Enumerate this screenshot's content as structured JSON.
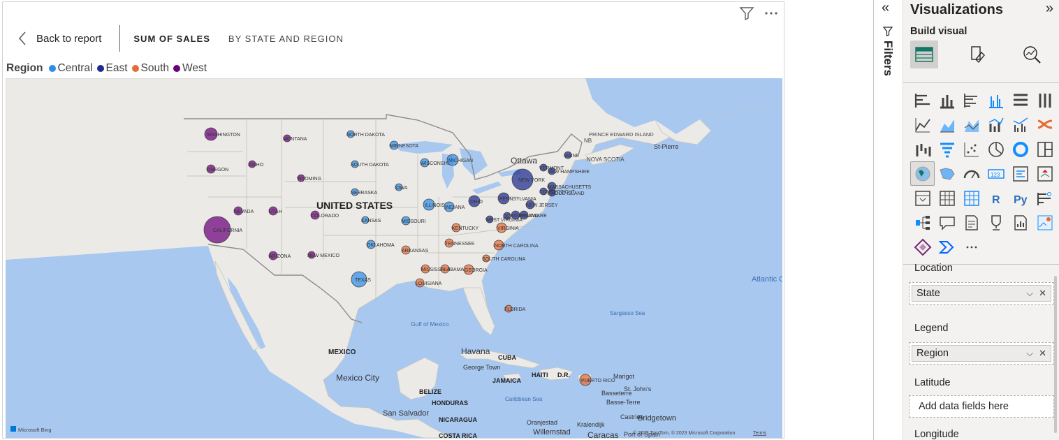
{
  "header": {
    "back_label": "Back to report",
    "crumbs": [
      "SUM OF SALES",
      "BY STATE AND REGION"
    ]
  },
  "legend": {
    "title": "Region",
    "items": [
      {
        "label": "Central",
        "color": "#2e8de6"
      },
      {
        "label": "East",
        "color": "#1b2b8f"
      },
      {
        "label": "South",
        "color": "#e66c37"
      },
      {
        "label": "West",
        "color": "#6b007b"
      }
    ]
  },
  "map": {
    "country_label": "UNITED STATES",
    "place_labels": {
      "mexico": "MEXICO",
      "mexico_city": "Mexico City",
      "cuba": "CUBA",
      "havana": "Havana",
      "george_town": "George Town",
      "jamaica": "JAMAICA",
      "haiti": "HAITI",
      "dr": "D.R.",
      "belize": "BELIZE",
      "honduras": "HONDURAS",
      "nicaragua": "NICARAGUA",
      "costa_rica": "COSTA RICA",
      "san_salvador": "San Salvador",
      "caribbean_sea": "Caribbean Sea",
      "gulf_of_mexico": "Gulf of Mexico",
      "sargasso_sea": "Sargasso Sea",
      "atlantic_ocean": "Atlantic Ocean",
      "ottawa": "Ottawa",
      "st_pierre": "St-Pierre",
      "nova_scotia": "NOVA SCOTIA",
      "pei": "PRINCE EDWARD ISLAND",
      "nb": "NB",
      "marigot": "Marigot",
      "st_johns": "St. John's",
      "basseterre": "Basseterre",
      "basse_terre": "Basse-Terre",
      "castries": "Castries",
      "bridgetown": "Bridgetown",
      "oranjestad": "Oranjestad",
      "kralendijk": "Kralendijk",
      "willemstad": "Willemstad",
      "caracas": "Caracas",
      "port_of_spain": "Port of Spain"
    },
    "attribution": "© 2022 TomTom, © 2023 Microsoft Corporation",
    "terms": "Terms",
    "bing": "Microsoft Bing",
    "bubbles": [
      {
        "state": "WASHINGTON",
        "region": "West",
        "size": 9
      },
      {
        "state": "OREGON",
        "region": "West",
        "size": 6
      },
      {
        "state": "CALIFORNIA",
        "region": "West",
        "size": 19
      },
      {
        "state": "NEVADA",
        "region": "West",
        "size": 6
      },
      {
        "state": "IDAHO",
        "region": "West",
        "size": 5
      },
      {
        "state": "MONTANA",
        "region": "West",
        "size": 5
      },
      {
        "state": "WYOMING",
        "region": "West",
        "size": 5
      },
      {
        "state": "UTAH",
        "region": "West",
        "size": 6
      },
      {
        "state": "COLORADO",
        "region": "West",
        "size": 6
      },
      {
        "state": "ARIZONA",
        "region": "West",
        "size": 6
      },
      {
        "state": "NEW MEXICO",
        "region": "West",
        "size": 5
      },
      {
        "state": "NORTH DAKOTA",
        "region": "Central",
        "size": 5
      },
      {
        "state": "SOUTH DAKOTA",
        "region": "Central",
        "size": 5
      },
      {
        "state": "NEBRASKA",
        "region": "Central",
        "size": 5
      },
      {
        "state": "KANSAS",
        "region": "Central",
        "size": 5
      },
      {
        "state": "OKLAHOMA",
        "region": "Central",
        "size": 6
      },
      {
        "state": "TEXAS",
        "region": "Central",
        "size": 11
      },
      {
        "state": "MINNESOTA",
        "region": "Central",
        "size": 6
      },
      {
        "state": "IOWA",
        "region": "Central",
        "size": 5
      },
      {
        "state": "MISSOURI",
        "region": "Central",
        "size": 6
      },
      {
        "state": "WISCONSIN",
        "region": "Central",
        "size": 6
      },
      {
        "state": "MICHIGAN",
        "region": "Central",
        "size": 8
      },
      {
        "state": "ILLINOIS",
        "region": "Central",
        "size": 8
      },
      {
        "state": "INDIANA",
        "region": "Central",
        "size": 7
      },
      {
        "state": "OHIO",
        "region": "East",
        "size": 8
      },
      {
        "state": "PENNSYLVANIA",
        "region": "East",
        "size": 8
      },
      {
        "state": "NEW YORK",
        "region": "East",
        "size": 15
      },
      {
        "state": "VERMONT",
        "region": "East",
        "size": 5
      },
      {
        "state": "NEW HAMPSHIRE",
        "region": "East",
        "size": 5
      },
      {
        "state": "MAINE",
        "region": "East",
        "size": 5
      },
      {
        "state": "MASSACHUSETTS",
        "region": "East",
        "size": 6
      },
      {
        "state": "RHODE ISLAND",
        "region": "East",
        "size": 5
      },
      {
        "state": "CONNECTICUT",
        "region": "East",
        "size": 5
      },
      {
        "state": "NEW JERSEY",
        "region": "East",
        "size": 6
      },
      {
        "state": "DELAWARE",
        "region": "East",
        "size": 6
      },
      {
        "state": "MARYLAND",
        "region": "East",
        "size": 6
      },
      {
        "state": "DC",
        "region": "East",
        "size": 5
      },
      {
        "state": "WEST VIRGINIA",
        "region": "East",
        "size": 5
      },
      {
        "state": "KENTUCKY",
        "region": "South",
        "size": 6
      },
      {
        "state": "VIRGINIA",
        "region": "South",
        "size": 7
      },
      {
        "state": "TENNESSEE",
        "region": "South",
        "size": 6
      },
      {
        "state": "NORTH CAROLINA",
        "region": "South",
        "size": 7
      },
      {
        "state": "SOUTH CAROLINA",
        "region": "South",
        "size": 5
      },
      {
        "state": "ARKANSAS",
        "region": "South",
        "size": 6
      },
      {
        "state": "MISSISSIPPI",
        "region": "South",
        "size": 6
      },
      {
        "state": "ALABAMA",
        "region": "South",
        "size": 6
      },
      {
        "state": "GEORGIA",
        "region": "South",
        "size": 7
      },
      {
        "state": "LOUISIANA",
        "region": "South",
        "size": 6
      },
      {
        "state": "FLORIDA",
        "region": "South",
        "size": 5
      },
      {
        "state": "PUERTO RICO",
        "region": "South",
        "size": 8
      }
    ]
  },
  "filters_pane": {
    "label": "Filters",
    "collapse_icon": "chevron-double-left-icon"
  },
  "viz_pane": {
    "title": "Visualizations",
    "build_visual_label": "Build visual",
    "wells": [
      {
        "label": "Location",
        "field": "State"
      },
      {
        "label": "Legend",
        "field": "Region"
      },
      {
        "label": "Latitude",
        "placeholder": "Add data fields here"
      },
      {
        "label": "Longitude"
      }
    ],
    "more_label": "···"
  }
}
